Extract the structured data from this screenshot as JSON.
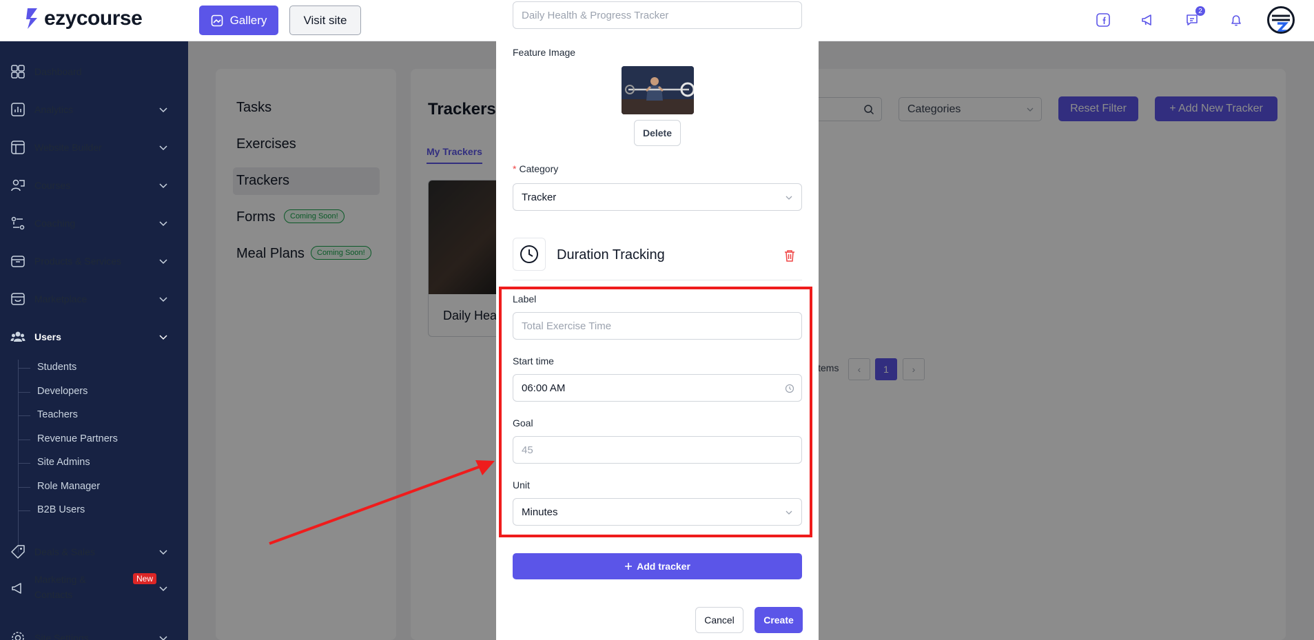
{
  "topbar": {
    "brand": "ezycourse",
    "gallery_label": "Gallery",
    "visit_label": "Visit site",
    "messages_badge": "2"
  },
  "sidebar": {
    "items": [
      {
        "label": "Dashboard"
      },
      {
        "label": "Analytics"
      },
      {
        "label": "Website Builder"
      },
      {
        "label": "Courses"
      },
      {
        "label": "Coaching"
      },
      {
        "label": "Products & Services"
      },
      {
        "label": "Marketplace"
      },
      {
        "label": "Users"
      },
      {
        "label": "Deals & Sales"
      },
      {
        "label": "Marketing &"
      },
      {
        "label": "Contacts"
      },
      {
        "label": "Site Settings"
      }
    ],
    "users_sub": [
      "Students",
      "Developers",
      "Teachers",
      "Revenue Partners",
      "Site Admins",
      "Role Manager",
      "B2B Users"
    ],
    "new_badge": "New"
  },
  "content": {
    "menu": [
      "Tasks",
      "Exercises",
      "Trackers",
      "Forms",
      "Meal Plans"
    ],
    "coming_soon": "Coming Soon!",
    "title": "Trackers",
    "tab": "My Trackers",
    "card_title": "Daily Health & Progress Tracker",
    "categories_placeholder": "Categories",
    "reset_label": "Reset Filter",
    "add_new_label": "+ Add New Tracker",
    "pager_text": "items",
    "page_current": "1"
  },
  "modal": {
    "title_value": "Daily Health & Progress Tracker",
    "feature_image_label": "Feature Image",
    "delete_label": "Delete",
    "category_label": "Category",
    "category_value": "Tracker",
    "tracker_type": "Duration Tracking",
    "label_label": "Label",
    "label_placeholder": "Total Exercise Time",
    "start_time_label": "Start time",
    "start_time_value": "06:00 AM",
    "goal_label": "Goal",
    "goal_placeholder": "45",
    "unit_label": "Unit",
    "unit_value": "Minutes",
    "add_tracker_label": "Add tracker",
    "cancel_label": "Cancel",
    "create_label": "Create"
  },
  "colors": {
    "accent": "#5b55e8",
    "sidebar_bg": "#172243",
    "highlight": "#ef1c1c"
  }
}
